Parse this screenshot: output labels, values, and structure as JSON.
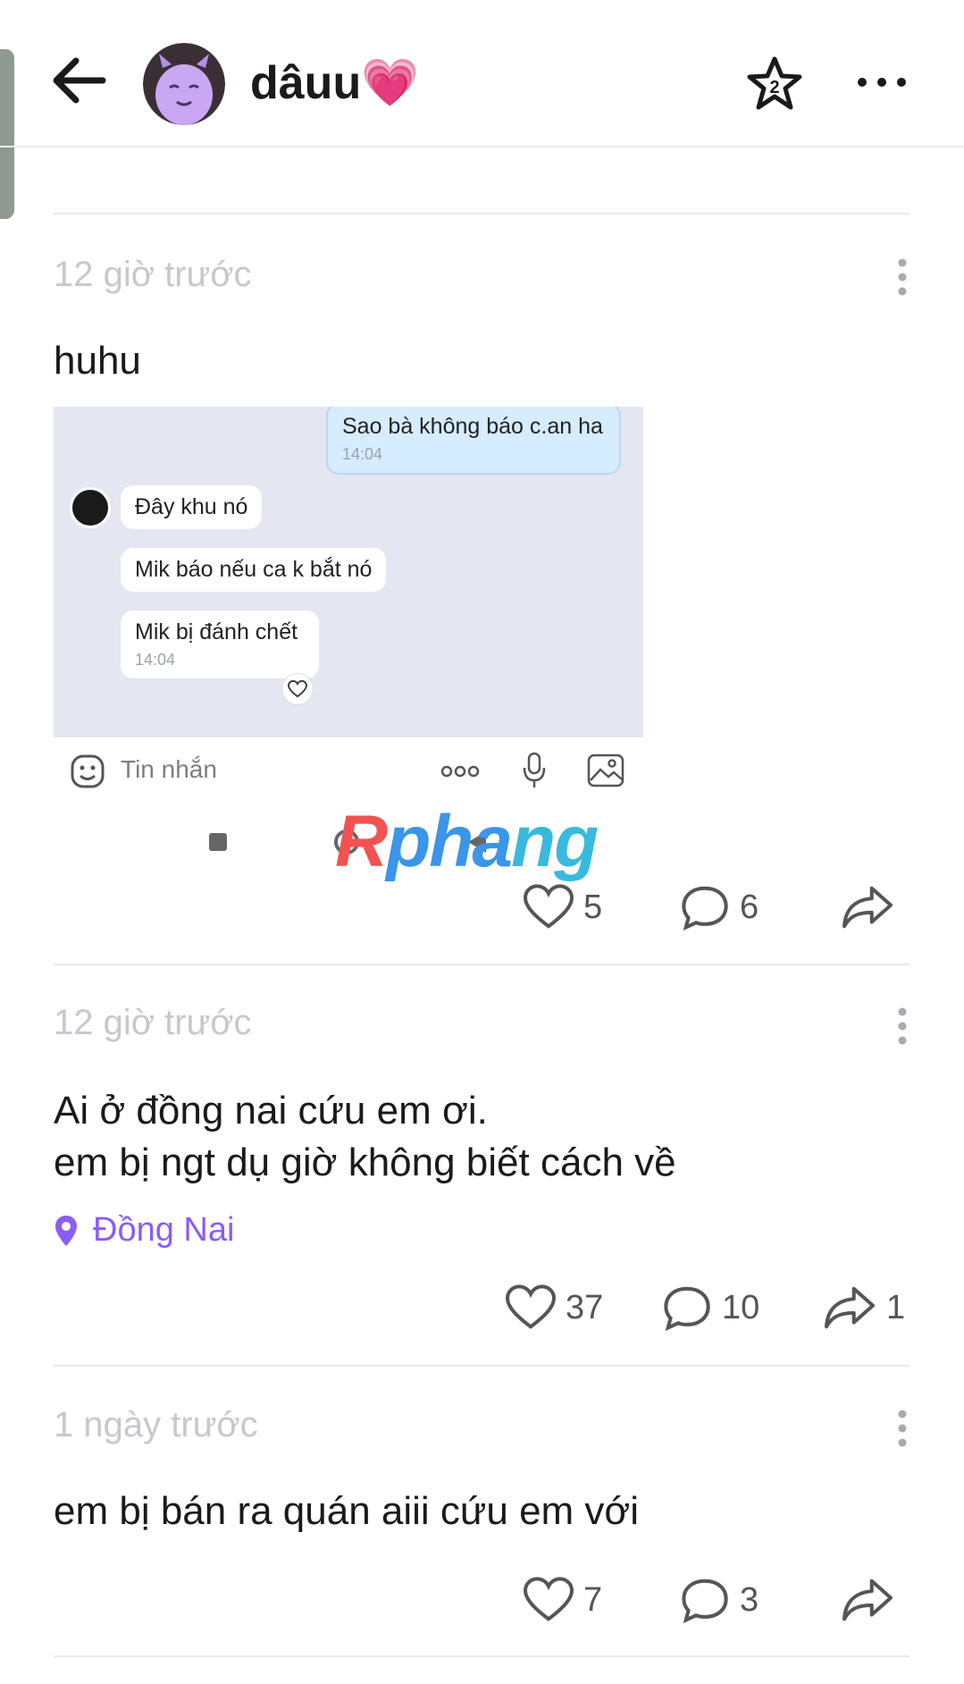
{
  "header": {
    "user_name": "dâuu💗",
    "back_icon": "arrow-left-icon",
    "star_icon": "star-badge-icon",
    "star_badge_number": "2",
    "more_icon": "more-horizontal-icon"
  },
  "posts": [
    {
      "time": "12 giờ trước",
      "text": "huhu",
      "screenshot": {
        "sent_message": "Sao bà không báo c.an ha",
        "sent_time": "14:04",
        "received": [
          "Đây khu nó",
          "Mik báo nếu ca k bắt nó",
          "Mik bị đánh chết"
        ],
        "received_time": "14:04",
        "composer_placeholder": "Tin nhắn"
      },
      "likes": "5",
      "comments": "6",
      "shares": ""
    },
    {
      "time": "12 giờ trước",
      "text": "Ai ở đồng nai cứu em ơi.\nem bị ngt dụ giờ không biết cách về",
      "location": "Đồng Nai",
      "likes": "37",
      "comments": "10",
      "shares": "1"
    },
    {
      "time": "1 ngày trước",
      "text": "em bị bán ra quán aiii cứu em với",
      "likes": "7",
      "comments": "3",
      "shares": ""
    }
  ],
  "watermark": {
    "part1": "R",
    "part2": "pha",
    "part3": "ng"
  },
  "colors": {
    "accent": "#8b5cf6",
    "muted_text": "#c7c7cf",
    "divider": "#e9e9ee",
    "chat_bg": "#e4e6f2"
  }
}
